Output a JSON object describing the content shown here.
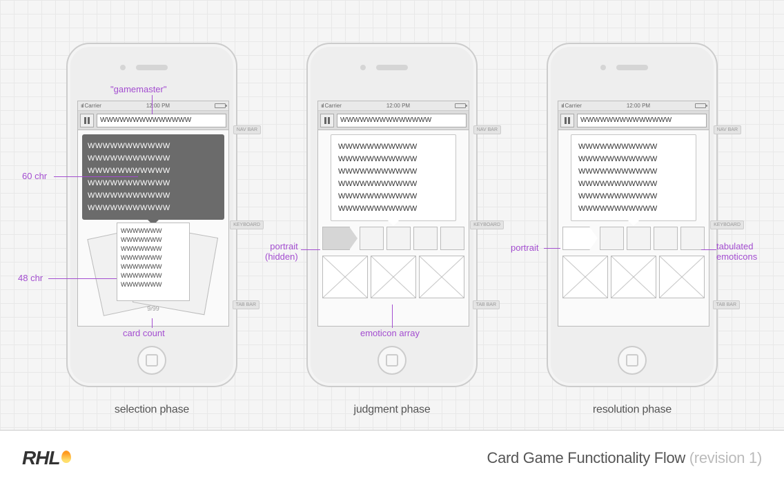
{
  "annotations": {
    "gamemaster": "\"gamemaster\"",
    "chr60": "60 chr",
    "chr48": "48 chr",
    "card_count": "card count",
    "portrait_hidden_l1": "portrait",
    "portrait_hidden_l2": "(hidden)",
    "emoticon_array": "emoticon array",
    "portrait": "portrait",
    "tab_emoticons_l1": "tabulated",
    "tab_emoticons_l2": "emoticons"
  },
  "status": {
    "carrier": "Carrier",
    "time": "12:00 PM",
    "signal": "ııl"
  },
  "nav_text": "WWWWWWWWWWWWWW",
  "tooltip_line": "WWWWWWWWWWW",
  "card_line": "WWWWWWW",
  "card_counter": "9/99",
  "guides": {
    "navbar": "NAV BAR",
    "keyboard": "KEYBOARD",
    "tabbar": "TAB BAR"
  },
  "captions": {
    "selection": "selection phase",
    "judgment": "judgment phase",
    "resolution": "resolution phase"
  },
  "footer": {
    "logo": "RHL",
    "title": "Card Game Functionality Flow",
    "revision": "(revision 1)"
  },
  "colors": {
    "annotation": "#a34dd0"
  }
}
